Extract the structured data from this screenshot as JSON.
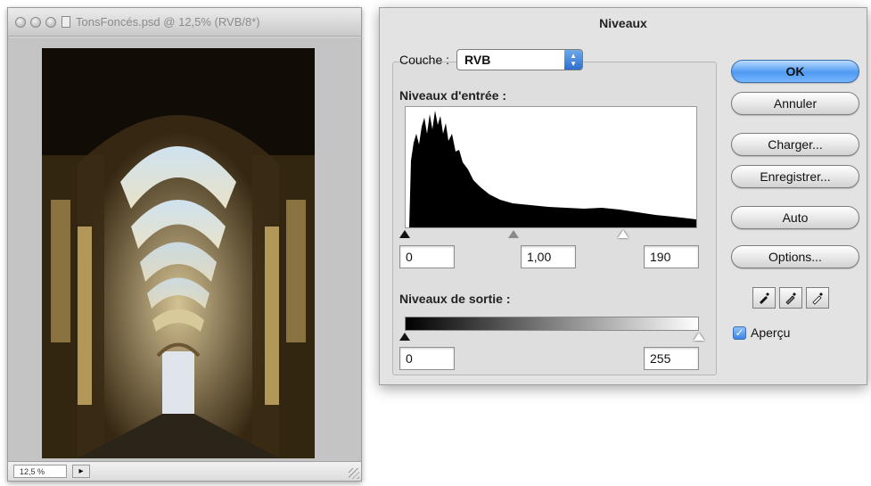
{
  "document_window": {
    "title": "TonsFoncés.psd @ 12,5% (RVB/8*)",
    "zoom": "12,5 %"
  },
  "levels_dialog": {
    "title": "Niveaux",
    "channel_label": "Couche :",
    "channel_value": "RVB",
    "input_levels_label": "Niveaux d'entrée :",
    "input_black": "0",
    "input_gamma": "1,00",
    "input_white": "190",
    "output_levels_label": "Niveaux de sortie :",
    "output_black": "0",
    "output_white": "255",
    "buttons": {
      "ok": "OK",
      "cancel": "Annuler",
      "load": "Charger...",
      "save": "Enregistrer...",
      "auto": "Auto",
      "options": "Options..."
    },
    "preview_label": "Aperçu",
    "preview_checked": true
  },
  "icons": [
    "close-icon",
    "minimize-icon",
    "zoom-icon",
    "document-icon",
    "black-eyedropper-icon",
    "gray-eyedropper-icon",
    "white-eyedropper-icon",
    "checkmark-icon"
  ]
}
